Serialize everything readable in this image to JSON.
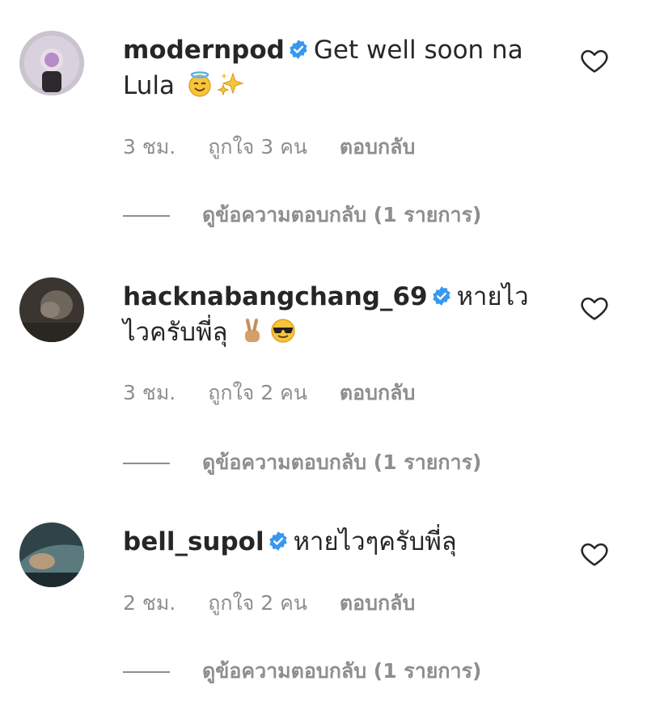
{
  "comments": [
    {
      "username": "modernpod",
      "text": "Get well soon na Lula",
      "time": "3 ชม.",
      "likes": "ถูกใจ 3 คน",
      "reply_label": "ตอบกลับ",
      "view_replies": "ดูข้อความตอบกลับ (1 รายการ)",
      "emojis": [
        "halo-face-emoji",
        "sparkles-emoji"
      ]
    },
    {
      "username": "hacknabangchang_69",
      "text": "หายไวไวครับพี่ลุ",
      "time": "3 ชม.",
      "likes": "ถูกใจ 2 คน",
      "reply_label": "ตอบกลับ",
      "view_replies": "ดูข้อความตอบกลับ (1 รายการ)",
      "emojis": [
        "victory-hand-emoji",
        "sunglasses-face-emoji"
      ]
    },
    {
      "username": "bell_supol",
      "text": "หายไวๆครับพี่ลุ",
      "time": "2 ชม.",
      "likes": "ถูกใจ 2 คน",
      "reply_label": "ตอบกลับ",
      "view_replies": "ดูข้อความตอบกลับ (1 รายการ)",
      "emojis": []
    }
  ],
  "colors": {
    "text": "#262626",
    "secondary": "#8e8e8e",
    "verified": "#3897f0"
  }
}
